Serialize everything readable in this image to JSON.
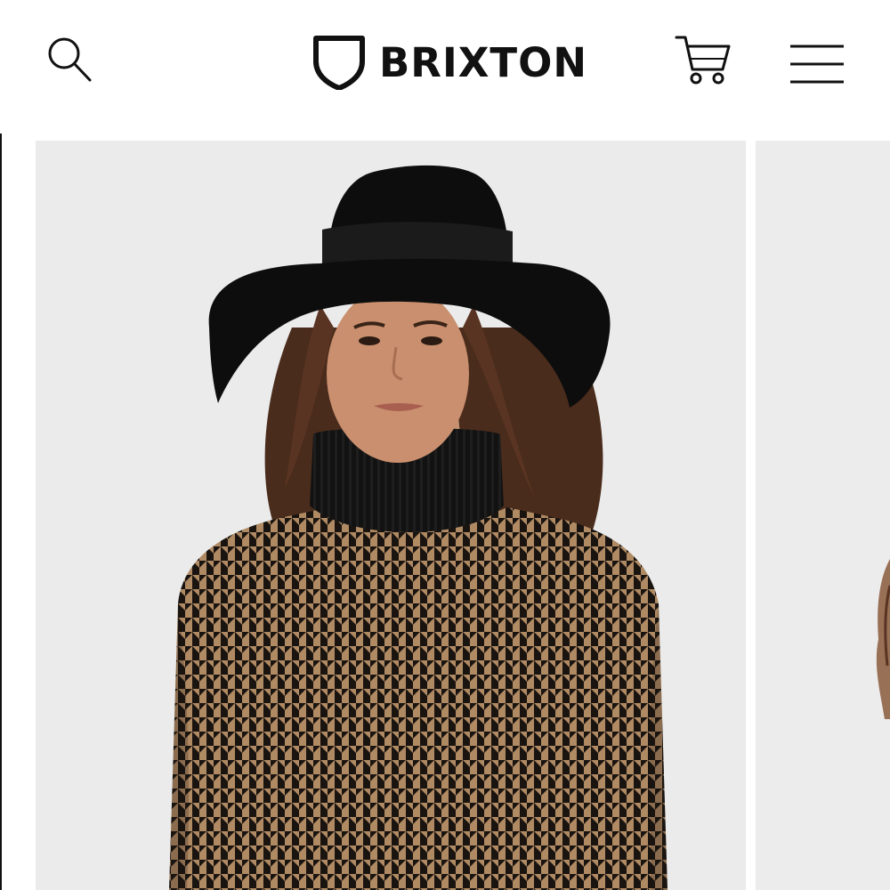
{
  "header": {
    "brand_name": "BRIXTON",
    "icons": {
      "search": "search-icon",
      "logo": "shield-logo-icon",
      "cart": "cart-icon",
      "menu": "hamburger-menu-icon"
    }
  },
  "colors": {
    "ink": "#111111",
    "product_background": "#ebebeb",
    "hat": "#0d0d0d",
    "sweater_tan": "#b08a63",
    "sweater_dark": "#1a1410"
  }
}
